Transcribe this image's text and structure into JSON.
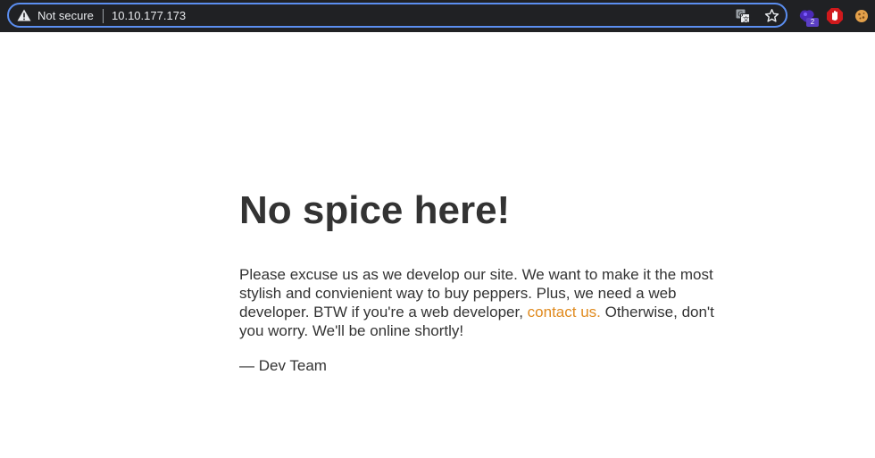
{
  "browser": {
    "security_label": "Not secure",
    "url": "10.10.177.173",
    "extension_badge": "2",
    "icons": [
      "warning-icon",
      "translate-icon",
      "star-icon",
      "extension-icon",
      "adblock-icon",
      "cookie-icon"
    ]
  },
  "page": {
    "title": "No spice here!",
    "message_before_link": "Please excuse us as we develop our site. We want to make it the most stylish and convienient way to buy peppers. Plus, we need a web developer. BTW if you're a web developer, ",
    "link_text": "contact us.",
    "message_after_link": " Otherwise, don't you worry. We'll be online shortly!",
    "signature": "— Dev Team",
    "link_color": "#e08a1e",
    "text_color": "#333333"
  }
}
